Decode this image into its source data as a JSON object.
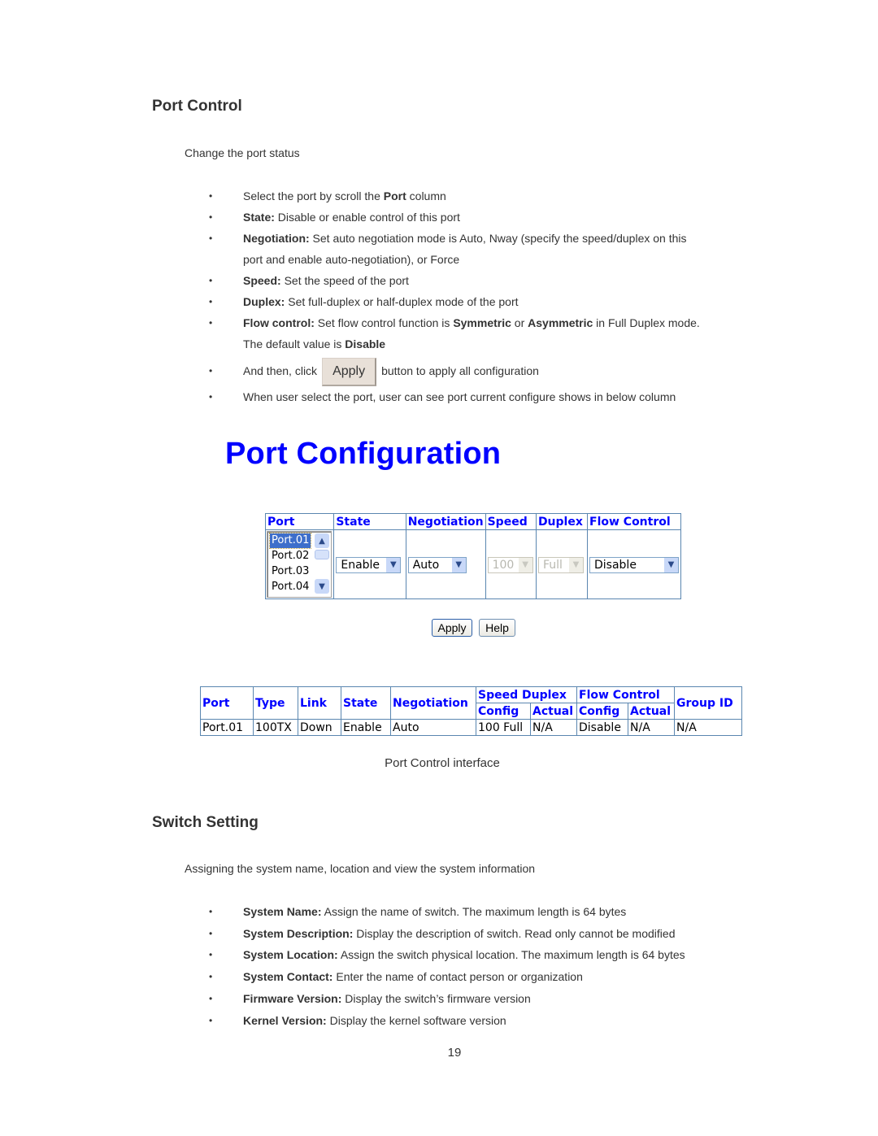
{
  "port_control": {
    "heading": "Port Control",
    "intro": "Change the port status",
    "bullets": [
      {
        "pre": "Select the port by scroll the ",
        "bold": "Port",
        "post": " column"
      },
      {
        "bold": "State:",
        "text": " Disable or enable control of this port"
      },
      {
        "bold": "Negotiation:",
        "text": " Set auto negotiation mode is Auto, Nway (specify the speed/duplex on this",
        "text2": "port and enable auto-negotiation), or Force"
      },
      {
        "bold": "Speed:",
        "text": " Set the speed of the port"
      },
      {
        "bold": "Duplex:",
        "text": " Set full-duplex or half-duplex mode of the port"
      },
      {
        "bold": "Flow control:",
        "text": " Set flow control function is ",
        "bold2": "Symmetric",
        "mid": " or ",
        "bold3": "Asymmetric",
        "tail": " in Full Duplex mode.",
        "line2_pre": "The default value is ",
        "line2_bold": "Disable"
      },
      {
        "pre": "And then, click",
        "button": "Apply",
        "post": "button to apply all configuration"
      },
      {
        "text": "When user select the port, user can see port current configure shows in below column"
      }
    ],
    "bullet_glyph": "•"
  },
  "port_configuration": {
    "title": "Port Configuration",
    "headers": [
      "Port",
      "State",
      "Negotiation",
      "Speed",
      "Duplex",
      "Flow Control"
    ],
    "port_list": {
      "options": [
        "Port.01",
        "Port.02",
        "Port.03",
        "Port.04"
      ],
      "selected": "Port.01"
    },
    "state": "Enable",
    "negotiation": "Auto",
    "speed": "100",
    "duplex": "Full",
    "flow_control": "Disable",
    "arrow_down": "▼",
    "arrow_up": "▲",
    "apply_button": "Apply",
    "help_button": "Help"
  },
  "status_table": {
    "headers": {
      "port": "Port",
      "type": "Type",
      "link": "Link",
      "state": "State",
      "negotiation": "Negotiation",
      "speed_duplex": "Speed Duplex",
      "flow_control": "Flow Control",
      "group_id": "Group ID",
      "config": "Config",
      "actual": "Actual"
    },
    "rows": [
      {
        "port": "Port.01",
        "type": "100TX",
        "link": "Down",
        "state": "Enable",
        "negotiation": "Auto",
        "sd_config": "100 Full",
        "sd_actual": "N/A",
        "fc_config": "Disable",
        "fc_actual": "N/A",
        "group_id": "N/A"
      }
    ]
  },
  "caption": "Port Control interface",
  "switch_setting": {
    "heading": "Switch Setting",
    "intro": "Assigning the system name, location and view the system information",
    "bullets": [
      {
        "bold": "System Name:",
        "text": " Assign the name of switch. The maximum length is 64 bytes"
      },
      {
        "bold": "System Description:",
        "text": " Display the description of switch. Read only cannot be modified"
      },
      {
        "bold": "System Location:",
        "text": " Assign the switch physical location. The maximum length is 64 bytes"
      },
      {
        "bold": "System Contact:",
        "text": " Enter the name of contact person or organization"
      },
      {
        "bold": "Firmware Version:",
        "text": " Display the switch’s firmware version"
      },
      {
        "bold": "Kernel Version:",
        "text": " Display the kernel software version"
      }
    ]
  },
  "page_number": "19"
}
